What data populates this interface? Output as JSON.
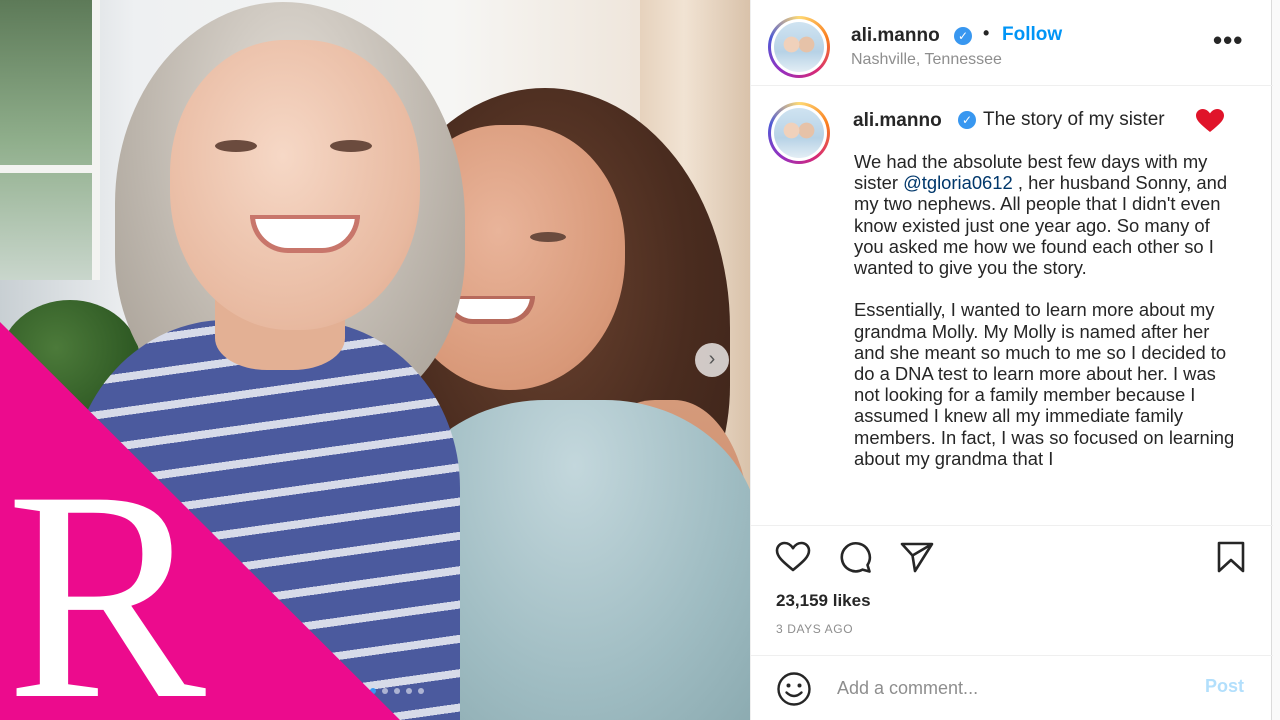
{
  "post": {
    "username": "ali.manno",
    "follow_label": "Follow",
    "separator": "•",
    "location": "Nashville, Tennessee",
    "more_label": "•••",
    "caption_title": "The story of my sister",
    "caption_p1_a": "We had the absolute best few days with my sister ",
    "caption_mention": "@tgloria0612",
    "caption_p1_b": " , her husband Sonny, and my two nephews. All people that I didn't even know existed just one year ago. So many of you asked me how we found each other so I wanted to give you the story.",
    "caption_p2": "Essentially, I wanted to learn more about my grandma Molly. My Molly is named after her and she meant so much to me so I decided to do a DNA test to learn more about her. I was not looking for a family member because I assumed I knew all my immediate family members. In fact, I was so focused on learning about my grandma that I",
    "likes": "23,159 likes",
    "time_ago": "3 DAYS AGO",
    "comment_placeholder": "Add a comment...",
    "post_label": "Post"
  },
  "brand": {
    "letter": "R",
    "color": "#ec0b8d"
  },
  "icons": {
    "heart": "heart-icon",
    "comment": "comment-icon",
    "share": "share-icon",
    "save": "bookmark-icon",
    "emoji": "emoji-icon",
    "verified": "verified-badge-icon",
    "next": "chevron-right-icon"
  },
  "carousel": {
    "next_glyph": "›"
  }
}
